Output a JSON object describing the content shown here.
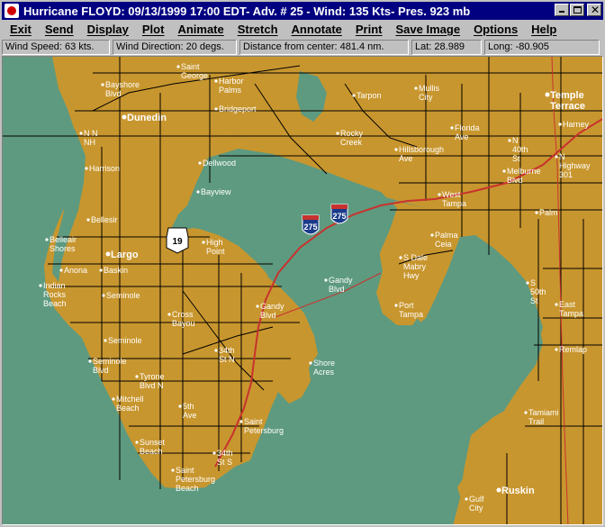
{
  "window": {
    "title": "Hurricane FLOYD: 09/13/1999 17:00 EDT- Adv. # 25 - Wind: 135 Kts- Pres. 923 mb"
  },
  "menu": [
    "Exit",
    "Send",
    "Display",
    "Plot",
    "Animate",
    "Stretch",
    "Annotate",
    "Print",
    "Save Image",
    "Options",
    "Help"
  ],
  "status": {
    "wind_speed": "Wind Speed: 63 kts.",
    "wind_direction": "Wind Direction: 20 degs.",
    "distance": "Distance from center: 481.4 nm.",
    "lat": "Lat: 28.989",
    "long": "Long: -80.905"
  },
  "map": {
    "colors": {
      "land": "#c8962e",
      "water": "#5e9a80",
      "road": "#000000",
      "interstate": "#c8322e",
      "label": "#ffffff"
    },
    "interstate_shields": [
      "275",
      "275"
    ],
    "us_shield": "19",
    "places": {
      "saint_george": "Saint\nGeorge",
      "harbor_palms": "Harbor\nPalms",
      "bayshore_blvd": "Bayshore\nBlvd",
      "dunedin": "Dunedin",
      "bridgeport": "Bridgeport",
      "tarpon": "Tarpon",
      "mullis_city": "Mullis\nCity",
      "temple_terrace": "Temple\nTerrace",
      "harney": "Harney",
      "florida_ave": "Florida\nAve",
      "rocky_creek": "Rocky\nCreek",
      "hillsborough_ave": "Hillsborough\nAve",
      "n_st_40th": "N\n40th\nSt",
      "highway_301": "N\nHighway\n301",
      "n_nh": "N N\nNH",
      "harrison": "Harrison",
      "dellwood": "Dellwood",
      "melburne_blvd": "Melburne\nBlvd",
      "bayview": "Bayview",
      "west_tampa": "West\nTampa",
      "palm": "Palm",
      "bellesir": "Bellesir",
      "belleair_shores": "Belleair\nShores",
      "largo": "Largo",
      "high_point": "High\nPoint",
      "palma_ceia": "Palma\nCeia",
      "anona": "Anona",
      "baskin": "Baskin",
      "s_dale_mabry": "S Dale\nMabry\nHwy",
      "indian_rocks_beach": "Indian\nRocks\nBeach",
      "seminole": "Seminole",
      "gandy_blvd_e": "Gandy\nBlvd",
      "s_st_50th": "S\n50th\nSt",
      "gandy_blvd_w": "Gandy\nBlvd",
      "east_tampa": "East\nTampa",
      "cross_bayou": "Cross\nBayou",
      "port_tampa": "Port\nTampa",
      "seminole_s": "Seminole",
      "st_34th_n": "34th\nSt N",
      "shore_acres": "Shore\nAcres",
      "remlap": "Remlap",
      "seminole_blvd": "Seminole\nBlvd",
      "tyrone_blvd": "Tyrone\nBlvd N",
      "mitchell_beach": "Mitchell\nBeach",
      "fifth_ave": "5th\nAve",
      "saint_petersburg": "Saint\nPetersburg",
      "tamiami_trail": "Tamiami\nTrail",
      "sunset_beach": "Sunset\nBeach",
      "st_34th_s": "34th\nSt S",
      "saint_petersburg_beach": "Saint\nPetersburg\nBeach",
      "ruskin": "Ruskin",
      "gulf_city": "Gulf\nCity"
    }
  }
}
